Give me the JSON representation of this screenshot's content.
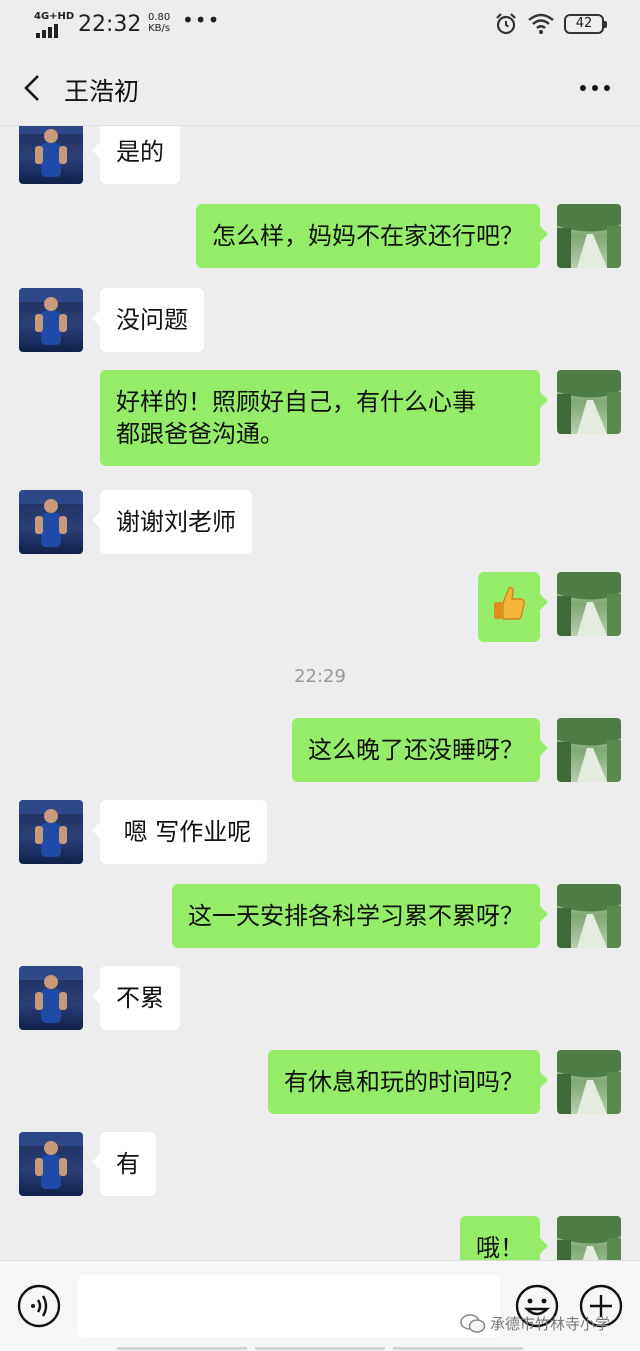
{
  "status_bar": {
    "network": "4G+HD",
    "time": "22:32",
    "speed_value": "0.80",
    "speed_unit": "KB/s",
    "battery": "42"
  },
  "header": {
    "title": "王浩初"
  },
  "messages": [
    {
      "side": "left",
      "text": "是的"
    },
    {
      "side": "right",
      "text": "怎么样，妈妈不在家还行吧？"
    },
    {
      "side": "left",
      "text": "没问题"
    },
    {
      "side": "right",
      "line1": "好样的！照顾好自己，有什么心事",
      "line2": "都跟爸爸沟通。"
    },
    {
      "side": "left",
      "text": "谢谢刘老师"
    },
    {
      "side": "right",
      "icon": "thumbs-up-icon"
    },
    {
      "side": "right",
      "text": "这么晚了还没睡呀？"
    },
    {
      "side": "left",
      "text": " 嗯 写作业呢"
    },
    {
      "side": "right",
      "text": "这一天安排各科学习累不累呀？"
    },
    {
      "side": "left",
      "text": "不累"
    },
    {
      "side": "right",
      "text": "有休息和玩的时间吗？"
    },
    {
      "side": "left",
      "text": "有"
    },
    {
      "side": "right",
      "text": "哦！"
    }
  ],
  "time_separator": "22:29",
  "input_bar": {
    "placeholder": "",
    "watermark": "承德市竹林寺小学"
  },
  "colors": {
    "background": "#ededed",
    "sent_bubble": "#95ec69",
    "received_bubble": "#ffffff"
  }
}
